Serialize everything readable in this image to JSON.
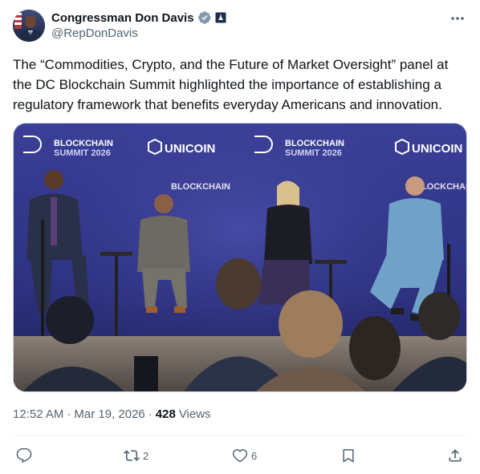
{
  "author": {
    "display_name": "Congressman Don Davis",
    "handle": "@RepDonDavis",
    "verified_icon": "verified-badge-icon",
    "affiliation_icon": "us-government-badge-icon"
  },
  "post": {
    "text": "The “Commodities, Crypto, and the Future of Market Oversight” panel at the DC Blockchain Summit highlighted the importance of establishing a regulatory framework that benefits everyday Americans and innovation.",
    "media": {
      "backdrop_logos": [
        "BLOCKCHAIN",
        "SUMMIT 2026",
        "UNICOIN"
      ]
    },
    "time": "12:52 AM",
    "date": "Mar 19, 2026",
    "views_count": "428",
    "views_label": "Views",
    "separator": "·"
  },
  "actions": {
    "reply": {
      "icon": "reply-icon",
      "count": ""
    },
    "repost": {
      "icon": "repost-icon",
      "count": "2"
    },
    "like": {
      "icon": "like-icon",
      "count": "6"
    },
    "bookmark": {
      "icon": "bookmark-icon"
    },
    "share": {
      "icon": "share-icon"
    }
  },
  "colors": {
    "text_primary": "#0f1419",
    "text_secondary": "#536471",
    "verified_blue": "#1d9bf0",
    "divider": "#eff3f4"
  }
}
